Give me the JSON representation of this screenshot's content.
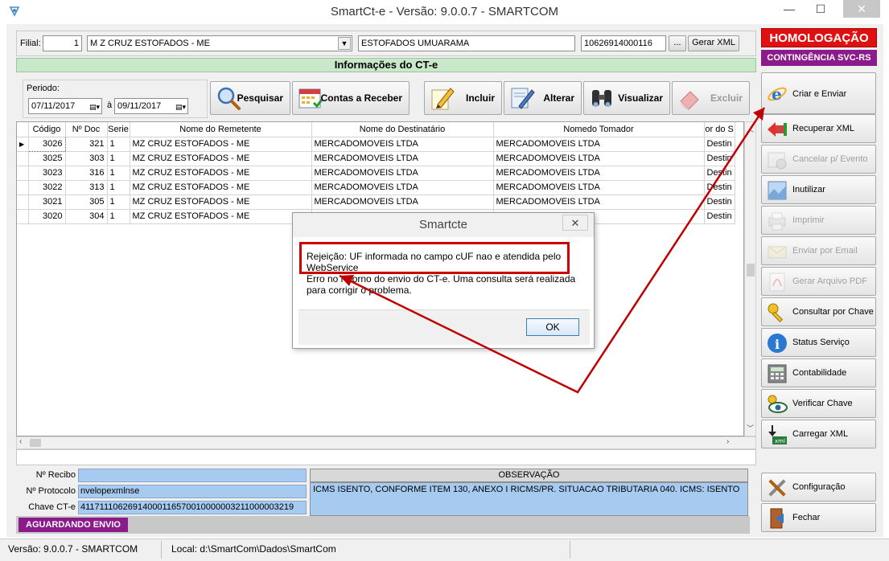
{
  "window": {
    "title": "SmartCt-e - Versão: 9.0.0.7 - SMARTCOM",
    "icons": {
      "app": "app-logo-icon",
      "min": "minimize-icon",
      "max": "maximize-icon",
      "close": "close-icon"
    }
  },
  "filial": {
    "label": "Filial:",
    "code": "1",
    "name": "M Z CRUZ ESTOFADOS - ME",
    "fantasia": "ESTOFADOS UMUARAMA",
    "cnpj": "10626914000116",
    "browse_label": "...",
    "gerar_xml_label": "Gerar XML"
  },
  "section_title": "Informações do CT-e",
  "periodo": {
    "label": "Periodo:",
    "from": "07/11/2017",
    "sep": "à",
    "to": "09/11/2017"
  },
  "toolbar": {
    "pesquisar": "Pesquisar",
    "contas_receber": "Contas a Receber",
    "incluir": "Incluir",
    "alterar": "Alterar",
    "visualizar": "Visualizar",
    "excluir": "Excluir"
  },
  "grid": {
    "columns": [
      "Código",
      "Nº Doc",
      "Serie",
      "Nome do Remetente",
      "Nome do Destinatário",
      "Nomedo Tomador",
      "or do S"
    ],
    "rows": [
      {
        "codigo": "3026",
        "doc": "321",
        "serie": "1",
        "remetente": "MZ CRUZ ESTOFADOS - ME",
        "destinatario": "MERCADOMOVEIS LTDA",
        "tomador": "MERCADOMOVEIS LTDA",
        "extra": "Destin"
      },
      {
        "codigo": "3025",
        "doc": "303",
        "serie": "1",
        "remetente": "MZ CRUZ ESTOFADOS - ME",
        "destinatario": "MERCADOMOVEIS LTDA",
        "tomador": "MERCADOMOVEIS LTDA",
        "extra": "Destin"
      },
      {
        "codigo": "3023",
        "doc": "316",
        "serie": "1",
        "remetente": "MZ CRUZ ESTOFADOS - ME",
        "destinatario": "MERCADOMOVEIS LTDA",
        "tomador": "MERCADOMOVEIS LTDA",
        "extra": "Destin"
      },
      {
        "codigo": "3022",
        "doc": "313",
        "serie": "1",
        "remetente": "MZ CRUZ ESTOFADOS - ME",
        "destinatario": "MERCADOMOVEIS LTDA",
        "tomador": "MERCADOMOVEIS LTDA",
        "extra": "Destin"
      },
      {
        "codigo": "3021",
        "doc": "305",
        "serie": "1",
        "remetente": "MZ CRUZ ESTOFADOS - ME",
        "destinatario": "MERCADOMOVEIS LTDA",
        "tomador": "MERCADOMOVEIS LTDA",
        "extra": "Destin"
      },
      {
        "codigo": "3020",
        "doc": "304",
        "serie": "1",
        "remetente": "MZ CRUZ ESTOFADOS - ME",
        "destinatario": "",
        "tomador": "",
        "extra": "Destin"
      }
    ]
  },
  "info": {
    "recibo_label": "Nº Recibo",
    "recibo_value": "",
    "protocolo_label": "Nº Protocolo",
    "protocolo_value": "nvelopexmlnse",
    "chave_label": "Chave CT-e",
    "chave_value": "41171110626914000116570010000003211000003219",
    "observacao_label": "OBSERVAÇÃO",
    "observacao_value": "ICMS ISENTO, CONFORME ITEM 130, ANEXO I RICMS/PR. SITUACAO TRIBUTARIA 040. ICMS: ISENTO"
  },
  "status": "AGUARDANDO ENVIO",
  "side": {
    "homologacao": "HOMOLOGAÇÃO",
    "contingencia": "CONTINGÊNCIA SVC-RS",
    "buttons": [
      {
        "label": "Criar e Enviar",
        "icon": "ie-send-icon",
        "enabled": true
      },
      {
        "label": "Recuperar XML",
        "icon": "recover-arrow-icon",
        "enabled": true
      },
      {
        "label": "Cancelar p/ Evento",
        "icon": "cancel-event-icon",
        "enabled": false
      },
      {
        "label": "Inutilizar",
        "icon": "inutilize-icon",
        "enabled": true
      },
      {
        "label": "Imprimir",
        "icon": "printer-icon",
        "enabled": false
      },
      {
        "label": "Enviar por Email",
        "icon": "email-icon",
        "enabled": false
      },
      {
        "label": "Gerar Arquivo PDF",
        "icon": "pdf-icon",
        "enabled": false
      },
      {
        "label": "Consultar por Chave",
        "icon": "key-icon",
        "enabled": true
      },
      {
        "label": "Status Serviço",
        "icon": "info-icon",
        "enabled": true
      },
      {
        "label": "Contabilidade",
        "icon": "calculator-icon",
        "enabled": true
      },
      {
        "label": "Verificar Chave",
        "icon": "key-eye-icon",
        "enabled": true
      },
      {
        "label": "Carregar XML",
        "icon": "xml-download-icon",
        "enabled": true
      },
      {
        "label": "Configuração",
        "icon": "tools-icon",
        "enabled": true
      },
      {
        "label": "Fechar",
        "icon": "exit-door-icon",
        "enabled": true
      }
    ]
  },
  "footer": {
    "version": "Versão: 9.0.0.7 - SMARTCOM",
    "local": "Local: d:\\SmartCom\\Dados\\SmartCom"
  },
  "dialog": {
    "title": "Smartcte",
    "close": "✕",
    "line1": "Rejeição: UF informada no campo cUF nao e atendida pelo",
    "line2": "WebService",
    "line3": "Erro no retorno do envio do CT-e. Uma consulta será realizada",
    "line4": "para corrigir o problema.",
    "ok": "OK"
  },
  "colors": {
    "homologacao_bg": "#e01010",
    "contingencia_bg": "#8b1a8b",
    "section_bg": "#c9e8c9",
    "field_blue": "#a6caf0",
    "annotation_red": "#c00000"
  }
}
